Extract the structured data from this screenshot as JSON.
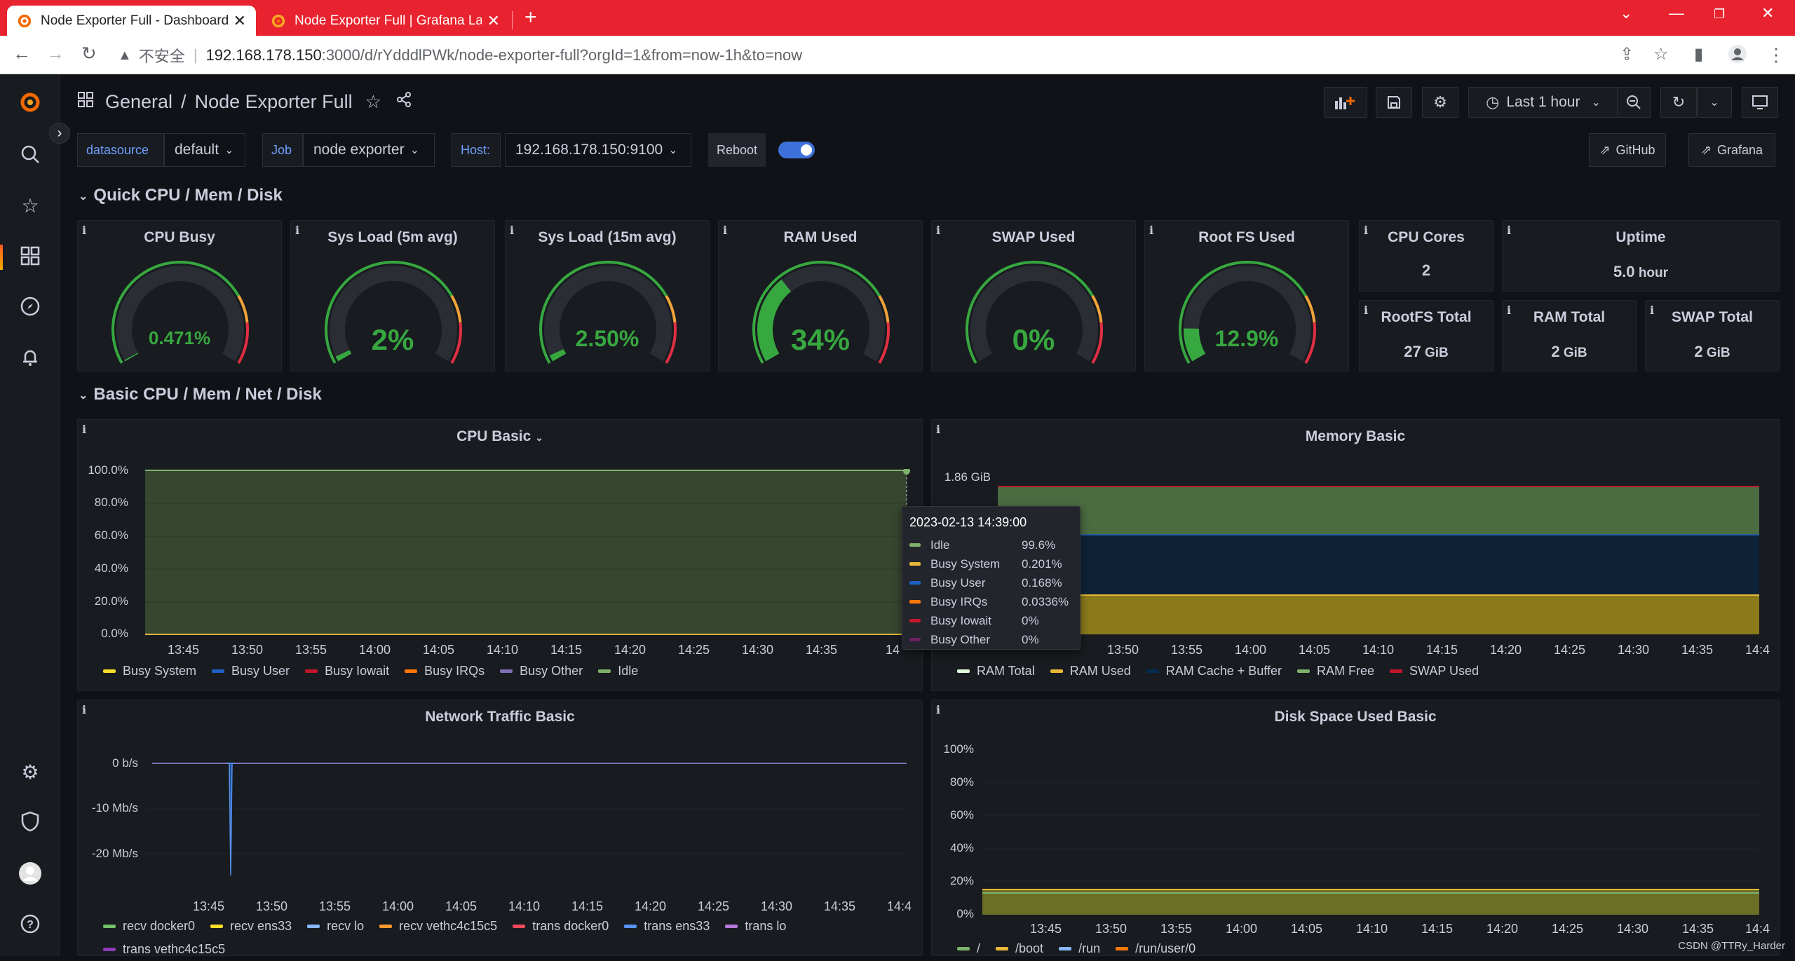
{
  "browser": {
    "tabs": [
      {
        "title": "Node Exporter Full - Dashboard",
        "active": true
      },
      {
        "title": "Node Exporter Full | Grafana Labs",
        "active": false
      }
    ],
    "address": {
      "security": "不安全",
      "host": "192.168.178.150",
      "path": ":3000/d/rYdddlPWk/node-exporter-full?orgId=1&from=now-1h&to=now"
    }
  },
  "header": {
    "folder": "General",
    "dashboard": "Node Exporter Full",
    "time_range": "Last 1 hour"
  },
  "variables": {
    "datasource_label": "datasource",
    "datasource_value": "default",
    "job_label": "Job",
    "job_value": "node exporter",
    "host_label": "Host:",
    "host_value": "192.168.178.150:9100",
    "reboot_label": "Reboot",
    "github_label": "GitHub",
    "grafana_label": "Grafana"
  },
  "rows": {
    "quick": "Quick CPU / Mem / Disk",
    "basic": "Basic CPU / Mem / Net / Disk"
  },
  "gauges": [
    {
      "title": "CPU Busy",
      "value": "0.471%",
      "fraction": 0.00471
    },
    {
      "title": "Sys Load (5m avg)",
      "value": "2%",
      "fraction": 0.02
    },
    {
      "title": "Sys Load (15m avg)",
      "value": "2.50%",
      "fraction": 0.025
    },
    {
      "title": "RAM Used",
      "value": "34%",
      "fraction": 0.34
    },
    {
      "title": "SWAP Used",
      "value": "0%",
      "fraction": 0.0
    },
    {
      "title": "Root FS Used",
      "value": "12.9%",
      "fraction": 0.129
    }
  ],
  "stats": {
    "cpu_cores": {
      "title": "CPU Cores",
      "value": "2"
    },
    "uptime": {
      "title": "Uptime",
      "value": "5.0",
      "unit": " hour"
    },
    "rootfs_total": {
      "title": "RootFS Total",
      "value": "27",
      "unit": " GiB"
    },
    "ram_total": {
      "title": "RAM Total",
      "value": "2",
      "unit": " GiB"
    },
    "swap_total": {
      "title": "SWAP Total",
      "value": "2",
      "unit": " GiB"
    }
  },
  "cpu_basic": {
    "title": "CPU Basic",
    "y_ticks": [
      "100.0%",
      "80.0%",
      "60.0%",
      "40.0%",
      "20.0%",
      "0.0%"
    ],
    "x_ticks": [
      "13:45",
      "13:50",
      "13:55",
      "14:00",
      "14:05",
      "14:10",
      "14:15",
      "14:20",
      "14:25",
      "14:30",
      "14:35",
      "14"
    ],
    "legend": [
      {
        "name": "Busy System",
        "color": "#fade2a"
      },
      {
        "name": "Busy User",
        "color": "#1f60c4"
      },
      {
        "name": "Busy Iowait",
        "color": "#c4162a"
      },
      {
        "name": "Busy IRQs",
        "color": "#ff780a"
      },
      {
        "name": "Busy Other",
        "color": "#806eb7"
      },
      {
        "name": "Idle",
        "color": "#7eb26d"
      }
    ]
  },
  "tooltip": {
    "time": "2023-02-13 14:39:00",
    "rows": [
      {
        "name": "Idle",
        "value": "99.6%",
        "color": "#7eb26d"
      },
      {
        "name": "Busy System",
        "value": "0.201%",
        "color": "#eab839"
      },
      {
        "name": "Busy User",
        "value": "0.168%",
        "color": "#1f60c4"
      },
      {
        "name": "Busy IRQs",
        "value": "0.0336%",
        "color": "#ff780a"
      },
      {
        "name": "Busy Iowait",
        "value": "0%",
        "color": "#c4162a"
      },
      {
        "name": "Busy Other",
        "value": "0%",
        "color": "#6d1f62"
      }
    ]
  },
  "memory_basic": {
    "title": "Memory Basic",
    "y_ticks": [
      "1.86 GiB"
    ],
    "x_ticks": [
      "13:50",
      "13:55",
      "14:00",
      "14:05",
      "14:10",
      "14:15",
      "14:20",
      "14:25",
      "14:30",
      "14:35",
      "14:4"
    ],
    "legend": [
      {
        "name": "RAM Total",
        "color": "#e0f9d7"
      },
      {
        "name": "RAM Used",
        "color": "#eab839"
      },
      {
        "name": "RAM Cache + Buffer",
        "color": "#052b51"
      },
      {
        "name": "RAM Free",
        "color": "#7eb26d"
      },
      {
        "name": "SWAP Used",
        "color": "#c4162a"
      }
    ]
  },
  "network_basic": {
    "title": "Network Traffic Basic",
    "y_ticks": [
      "0 b/s",
      "-10 Mb/s",
      "-20 Mb/s"
    ],
    "x_ticks": [
      "13:45",
      "13:50",
      "13:55",
      "14:00",
      "14:05",
      "14:10",
      "14:15",
      "14:20",
      "14:25",
      "14:30",
      "14:35",
      "14:4"
    ],
    "legend": [
      {
        "name": "recv docker0",
        "color": "#73bf69"
      },
      {
        "name": "recv ens33",
        "color": "#fade2a"
      },
      {
        "name": "recv lo",
        "color": "#8ab8ff"
      },
      {
        "name": "recv vethc4c15c5",
        "color": "#ff9830"
      },
      {
        "name": "trans docker0",
        "color": "#f2495c"
      },
      {
        "name": "trans ens33",
        "color": "#5794f2"
      },
      {
        "name": "trans lo",
        "color": "#b877d9"
      },
      {
        "name": "trans vethc4c15c5",
        "color": "#8f3bb8"
      }
    ]
  },
  "disk_basic": {
    "title": "Disk Space Used Basic",
    "y_ticks": [
      "100%",
      "80%",
      "60%",
      "40%",
      "20%",
      "0%"
    ],
    "x_ticks": [
      "13:45",
      "13:50",
      "13:55",
      "14:00",
      "14:05",
      "14:10",
      "14:15",
      "14:20",
      "14:25",
      "14:30",
      "14:35",
      "14:4"
    ],
    "legend": [
      {
        "name": "/",
        "color": "#7eb26d"
      },
      {
        "name": "/boot",
        "color": "#eab839"
      },
      {
        "name": "/run",
        "color": "#8ab8ff"
      },
      {
        "name": "/run/user/0",
        "color": "#ff780a"
      }
    ]
  },
  "watermark": "CSDN @TTRy_Harder"
}
